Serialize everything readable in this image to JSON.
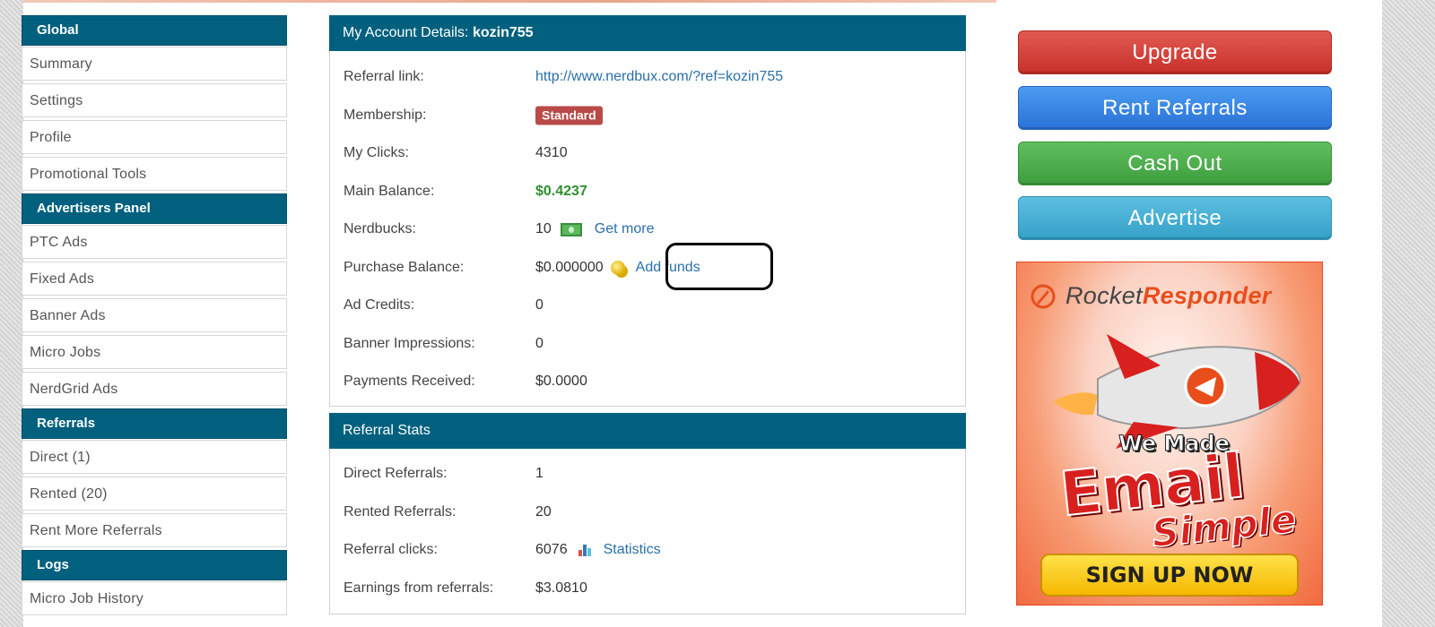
{
  "sidebar": {
    "sections": [
      {
        "title": "Global",
        "items": [
          "Summary",
          "Settings",
          "Profile",
          "Promotional Tools"
        ]
      },
      {
        "title": "Advertisers Panel",
        "items": [
          "PTC Ads",
          "Fixed Ads",
          "Banner Ads",
          "Micro Jobs",
          "NerdGrid Ads"
        ]
      },
      {
        "title": "Referrals",
        "items": [
          "Direct (1)",
          "Rented (20)",
          "Rent More Referrals"
        ]
      },
      {
        "title": "Logs",
        "items": [
          "Micro Job History"
        ]
      }
    ]
  },
  "account": {
    "title_prefix": "My Account Details: ",
    "username": "kozin755",
    "referral_link_label": "Referral link:",
    "referral_link": "http://www.nerdbux.com/?ref=kozin755",
    "membership_label": "Membership:",
    "membership": "Standard",
    "clicks_label": "My Clicks:",
    "clicks": "4310",
    "main_balance_label": "Main Balance:",
    "main_balance": "$0.4237",
    "nerdbucks_label": "Nerdbucks:",
    "nerdbucks": "10",
    "get_more": "Get more",
    "purchase_balance_label": "Purchase Balance:",
    "purchase_balance": "$0.000000",
    "add_funds": "Add funds",
    "ad_credits_label": "Ad Credits:",
    "ad_credits": "0",
    "banner_impressions_label": "Banner Impressions:",
    "banner_impressions": "0",
    "payments_received_label": "Payments Received:",
    "payments_received": "$0.0000"
  },
  "referral_stats": {
    "title": "Referral Stats",
    "direct_label": "Direct Referrals:",
    "direct": "1",
    "rented_label": "Rented Referrals:",
    "rented": "20",
    "clicks_label": "Referral clicks:",
    "clicks": "6076",
    "statistics_link": "Statistics",
    "earnings_label": "Earnings from referrals:",
    "earnings": "$3.0810"
  },
  "actions": {
    "upgrade": "Upgrade",
    "rent_referrals": "Rent Referrals",
    "cash_out": "Cash Out",
    "advertise": "Advertise"
  },
  "ad": {
    "brand_part1": "Rocket",
    "brand_part2": "Responder",
    "headline_top": "We Made",
    "headline_main": "Email",
    "headline_sub": "Simple",
    "cta": "SIGN UP NOW"
  },
  "colors": {
    "header_teal": "#00607e",
    "badge_red": "#b94a48",
    "balance_green": "#2f8f2f",
    "link_blue": "#2a6fa8"
  },
  "icons": {
    "nerdbucks": "money-icon",
    "purchase_balance": "coins-icon",
    "referral_clicks": "bar-chart-icon"
  }
}
